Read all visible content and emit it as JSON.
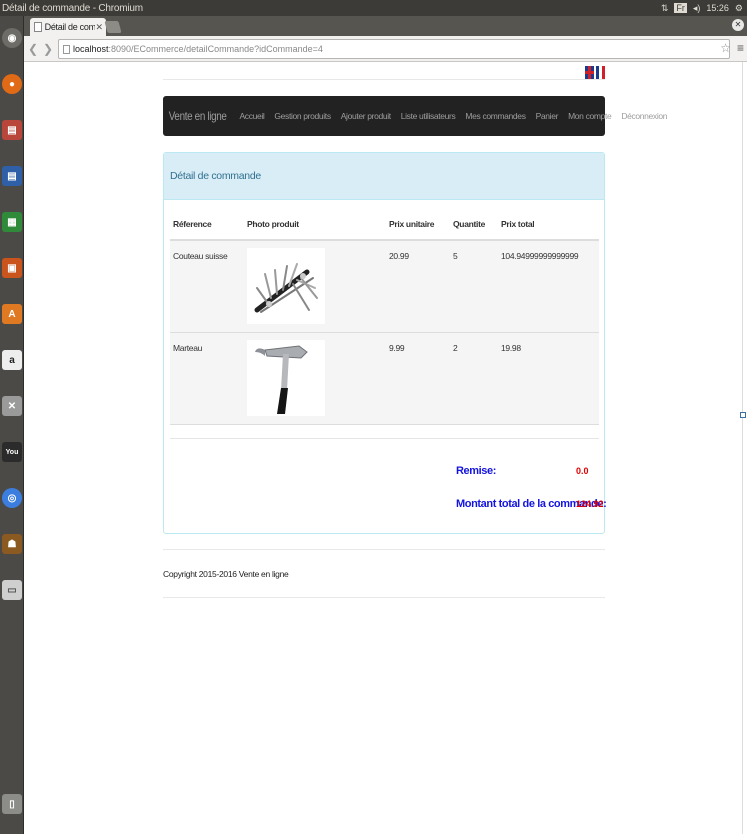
{
  "os": {
    "window_title": "Détail de commande - Chromium",
    "time": "15:26",
    "keyboard": "Fr"
  },
  "browser": {
    "tab_title": "Détail de commande",
    "url_host": "localhost",
    "url_path": ":8090/ECommerce/detailCommande?idCommande=4"
  },
  "launcher": {
    "items": [
      "dash-icon",
      "firefox-icon",
      "files-icon",
      "writer-icon",
      "calc-icon",
      "impress-icon",
      "software-center-icon",
      "amazon-icon",
      "settings-icon",
      "youtube-icon",
      "chromium-icon",
      "game-icon",
      "drive-icon",
      "trash-icon"
    ]
  },
  "nav": {
    "brand": "Vente en ligne",
    "items": [
      "Accueil",
      "Gestion produits",
      "Ajouter produit",
      "Liste utilisateurs",
      "Mes commandes",
      "Panier",
      "Mon compte",
      "Déconnexion"
    ]
  },
  "languages": [
    "en",
    "fr"
  ],
  "colors": {
    "navbar": "#222222",
    "panel_heading": "#d9edf7",
    "blue_label": "#1414e0",
    "red_value": "#e00000"
  },
  "panel": {
    "title": "Détail de commande"
  },
  "table": {
    "headers": [
      "Réference",
      "Photo produit",
      "Prix unitaire",
      "Quantite",
      "Prix total"
    ],
    "rows": [
      {
        "reference": "Couteau suisse",
        "photo": "multitool-photo",
        "prix_unitaire": "20.99",
        "quantite": "5",
        "prix_total": "104.94999999999999"
      },
      {
        "reference": "Marteau",
        "photo": "hammer-photo",
        "prix_unitaire": "9.99",
        "quantite": "2",
        "prix_total": "19.98"
      }
    ]
  },
  "totals": {
    "remise_label": "Remise:",
    "remise_value": "0.0",
    "total_label": "Montant total de la commande:",
    "total_value": "124.92"
  },
  "footer": {
    "copyright": "Copyright 2015-2016 Vente en ligne"
  }
}
